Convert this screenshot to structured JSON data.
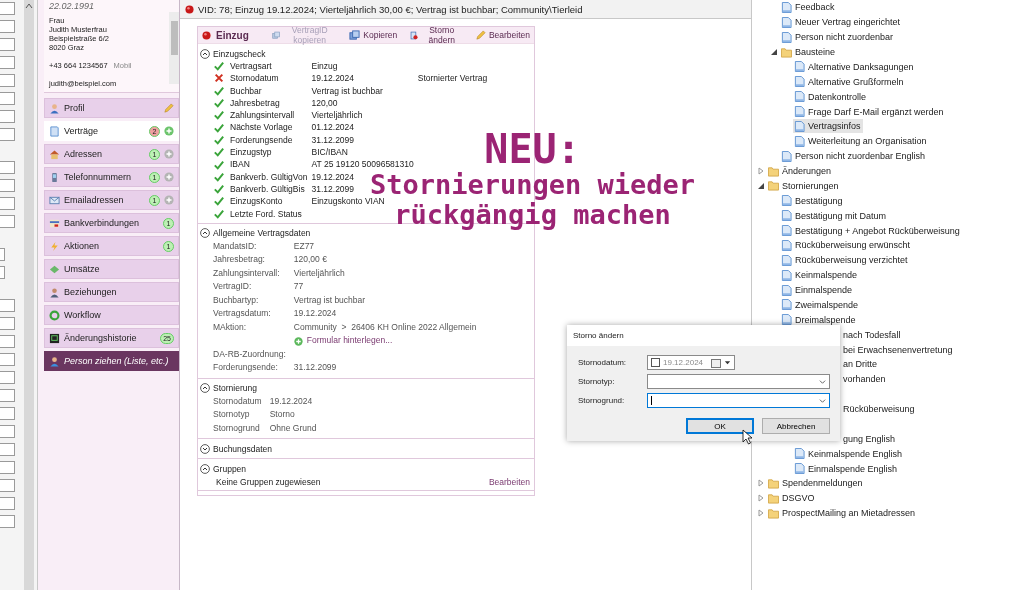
{
  "person": {
    "birthdate": "22.02.1991",
    "salutation": "Frau",
    "name": "Judith Musterfrau",
    "street": "Beispielstraße 6/2",
    "city": "8020 Graz",
    "phone": "+43 664 1234567",
    "phone_type": "Mobil",
    "email": "judith@beispiel.com"
  },
  "nav": [
    {
      "label": "Profil",
      "kind": "item",
      "selected": false,
      "editable": true,
      "add": false
    },
    {
      "label": "Verträge",
      "kind": "item",
      "selected": true,
      "editable": false,
      "add": true,
      "badge": {
        "count": "2",
        "color": "#f0a0a0"
      }
    },
    {
      "label": "Adressen",
      "kind": "item",
      "selected": false,
      "editable": false,
      "add": true,
      "badge": {
        "count": "1",
        "color": "#bdf0b4"
      }
    },
    {
      "label": "Telefonnummern",
      "kind": "item",
      "selected": false,
      "editable": false,
      "add": true,
      "badge": {
        "count": "1",
        "color": "#bdf0b4"
      }
    },
    {
      "label": "Emailadressen",
      "kind": "item",
      "selected": false,
      "editable": false,
      "add": true,
      "badge": {
        "count": "1",
        "color": "#bdf0b4"
      }
    },
    {
      "label": "Bankverbindungen",
      "kind": "item",
      "selected": false,
      "editable": false,
      "add": false,
      "badge": {
        "count": "1",
        "color": "#bdf0b4"
      }
    },
    {
      "label": "Aktionen",
      "kind": "item",
      "selected": false,
      "editable": false,
      "add": false,
      "badge": {
        "count": "1",
        "color": "#bdf0b4"
      }
    },
    {
      "label": "Umsätze",
      "kind": "item",
      "selected": false,
      "editable": false,
      "add": false
    },
    {
      "label": "Beziehungen",
      "kind": "item",
      "selected": false,
      "editable": false,
      "add": false
    },
    {
      "label": "Workflow",
      "kind": "item",
      "selected": false,
      "editable": false,
      "add": false
    },
    {
      "label": "Änderungshistorie",
      "kind": "item",
      "selected": false,
      "editable": false,
      "add": false,
      "badge": {
        "count": "25",
        "color": "#bdf0b4"
      }
    },
    {
      "label": "Person ziehen (Liste, etc.)",
      "kind": "action",
      "editable": false,
      "add": false
    }
  ],
  "status_bar": {
    "text": "VID: 78; Einzug 19.12.2024; Vierteljährlich 30,00 €; Vertrag ist buchbar; Community\\Tierleid"
  },
  "contract": {
    "title": "Einzug",
    "toolbar": [
      {
        "label": "VertragID kopieren",
        "disabled": true
      },
      {
        "label": "Kopieren",
        "disabled": false
      },
      {
        "label": "Storno ändern",
        "disabled": false
      },
      {
        "label": "Bearbeiten",
        "disabled": false
      }
    ],
    "sections": [
      {
        "title": "Einzugscheck",
        "expanded": true,
        "kind": "check",
        "rows": [
          {
            "ok": true,
            "label": "Vertragsart",
            "value": "Einzug"
          },
          {
            "ok": false,
            "label": "Stornodatum",
            "value": "19.12.2024",
            "note": "Stornierter Vertrag"
          },
          {
            "ok": true,
            "label": "Buchbar",
            "value": "Vertrag ist buchbar"
          },
          {
            "ok": true,
            "label": "Jahresbetrag",
            "value": "120,00"
          },
          {
            "ok": true,
            "label": "Zahlungsintervall",
            "value": "Vierteljährlich"
          },
          {
            "ok": true,
            "label": "Nächste Vorlage",
            "value": "01.12.2024"
          },
          {
            "ok": true,
            "label": "Forderungsende",
            "value": "31.12.2099"
          },
          {
            "ok": true,
            "label": "Einzugstyp",
            "value": "BIC/IBAN"
          },
          {
            "ok": true,
            "label": "IBAN",
            "value": "AT 25 19120 50096581310"
          },
          {
            "ok": true,
            "label": "Bankverb. GültigVon",
            "value": "19.12.2024"
          },
          {
            "ok": true,
            "label": "Bankverb. GültigBis",
            "value": "31.12.2099"
          },
          {
            "ok": true,
            "label": "EinzugsKonto",
            "value": "Einzugskonto VIAN"
          },
          {
            "ok": true,
            "label": "Letzte Ford. Status"
          }
        ]
      },
      {
        "title": "Allgemeine Vertragsdaten",
        "expanded": true,
        "kind": "fields",
        "rows": [
          {
            "label": "MandatsID:",
            "value": "EZ77"
          },
          {
            "label": "Jahresbetrag:",
            "value": "120,00 €"
          },
          {
            "label": "Zahlungsintervall:",
            "value": "Vierteljährlich"
          },
          {
            "label": "VertragID:",
            "value": "77"
          },
          {
            "label": "Buchbartyp:",
            "value": "Vertrag ist buchbar"
          },
          {
            "label": "Vertragsdatum:",
            "value": "19.12.2024"
          },
          {
            "label": "MAktion:",
            "value": "Community  >  26406 KH Online 2022 Allgemein"
          },
          {
            "link": "Formular hinterlegen..."
          },
          {
            "label": "DA-RB-Zuordnung:"
          },
          {
            "label": "Forderungsende:",
            "value": "31.12.2099"
          }
        ]
      },
      {
        "title": "Stornierung",
        "expanded": true,
        "kind": "fields",
        "rows": [
          {
            "label": "Stornodatum",
            "value": "19.12.2024"
          },
          {
            "label": "Stornotyp",
            "value": "Storno"
          },
          {
            "label": "Stornogrund",
            "value": "Ohne Grund"
          }
        ]
      },
      {
        "title": "Buchungsdaten",
        "expanded": false
      },
      {
        "title": "Gruppen",
        "expanded": true,
        "kind": "text",
        "text": "Keine Gruppen zugewiesen",
        "action": "Bearbeiten"
      }
    ]
  },
  "overlay": {
    "title": "NEU:",
    "lines": [
      "Stornierungen wieder",
      "rückgängig machen"
    ]
  },
  "dialog": {
    "title": "Storno ändern",
    "fields": [
      {
        "kind": "date",
        "label": "Stornodatum:",
        "value": "19.12.2024",
        "checked": false
      },
      {
        "kind": "combo",
        "label": "Stornotyp:",
        "focused": false
      },
      {
        "kind": "combo",
        "label": "Stornogrund:",
        "focused": true
      }
    ],
    "buttons": [
      {
        "label": "OK",
        "default": true
      },
      {
        "label": "Abbrechen",
        "default": false
      }
    ]
  },
  "tree": [
    {
      "kind": "scrolled_out",
      "children": [
        {
          "kind": "doc",
          "label": "Feedback",
          "selected": false
        },
        {
          "kind": "doc",
          "label": "Neuer Vertrag eingerichtet",
          "selected": false
        },
        {
          "kind": "doc",
          "label": "Person nicht zuordenbar",
          "selected": false
        },
        {
          "kind": "folder",
          "label": "Bausteine",
          "selected": false,
          "expanded": true,
          "children": [
            {
              "kind": "doc",
              "label": "Alternative Danksagungen",
              "selected": false
            },
            {
              "kind": "doc",
              "label": "Alternative Grußformeln",
              "selected": false
            },
            {
              "kind": "doc",
              "label": "Datenkontrolle",
              "selected": false
            },
            {
              "kind": "doc",
              "label": "Frage Darf E-Mail ergänzt werden",
              "selected": false
            },
            {
              "kind": "doc",
              "label": "Vertragsinfos",
              "selected": true
            },
            {
              "kind": "doc",
              "label": "Weiterleitung an Organisation",
              "selected": false
            }
          ]
        },
        {
          "kind": "doc",
          "label": "Person nicht zuordenbar English",
          "selected": false
        }
      ]
    },
    {
      "kind": "folder",
      "label": "Änderungen",
      "selected": false,
      "expanded": false
    },
    {
      "kind": "folder",
      "label": "Stornierungen",
      "selected": false,
      "expanded": true,
      "children": [
        {
          "kind": "doc",
          "label": "Bestätigung",
          "selected": false
        },
        {
          "kind": "doc",
          "label": "Bestätigung mit Datum",
          "selected": false
        },
        {
          "kind": "doc",
          "label": "Bestätigung + Angebot Rücküberweisung",
          "selected": false
        },
        {
          "kind": "doc",
          "label": "Rücküberweisung erwünscht",
          "selected": false
        },
        {
          "kind": "doc",
          "label": "Rücküberweisung verzichtet",
          "selected": false
        },
        {
          "kind": "doc",
          "label": "Keinmalspende",
          "selected": false
        },
        {
          "kind": "doc",
          "label": "Einmalspende",
          "selected": false
        },
        {
          "kind": "doc",
          "label": "Zweimalspende",
          "selected": false
        },
        {
          "kind": "doc",
          "label": "Dreimalspende",
          "selected": false
        },
        {
          "kind": "clipped",
          "label": "nach Todesfall"
        },
        {
          "kind": "clipped",
          "label": "bei Erwachsenenvertretung"
        },
        {
          "kind": "clipped",
          "label": "an Dritte"
        },
        {
          "kind": "clipped",
          "label": "vorhanden"
        },
        {
          "kind": "hidden"
        },
        {
          "kind": "clipped",
          "label": "Rücküberweisung"
        },
        {
          "kind": "hidden",
          "children": [
            {
              "kind": "clipped",
              "label": "gung English"
            },
            {
              "kind": "doc",
              "label": "Keinmalspende English",
              "selected": false
            },
            {
              "kind": "doc",
              "label": "Einmalspende English",
              "selected": false
            }
          ]
        }
      ]
    },
    {
      "kind": "folder",
      "label": "Spendenmeldungen",
      "selected": false,
      "expanded": false
    },
    {
      "kind": "folder",
      "label": "DSGVO",
      "selected": false,
      "expanded": false
    },
    {
      "kind": "folder",
      "label": "ProspectMailing an Mietadressen",
      "selected": false,
      "expanded": false
    }
  ]
}
